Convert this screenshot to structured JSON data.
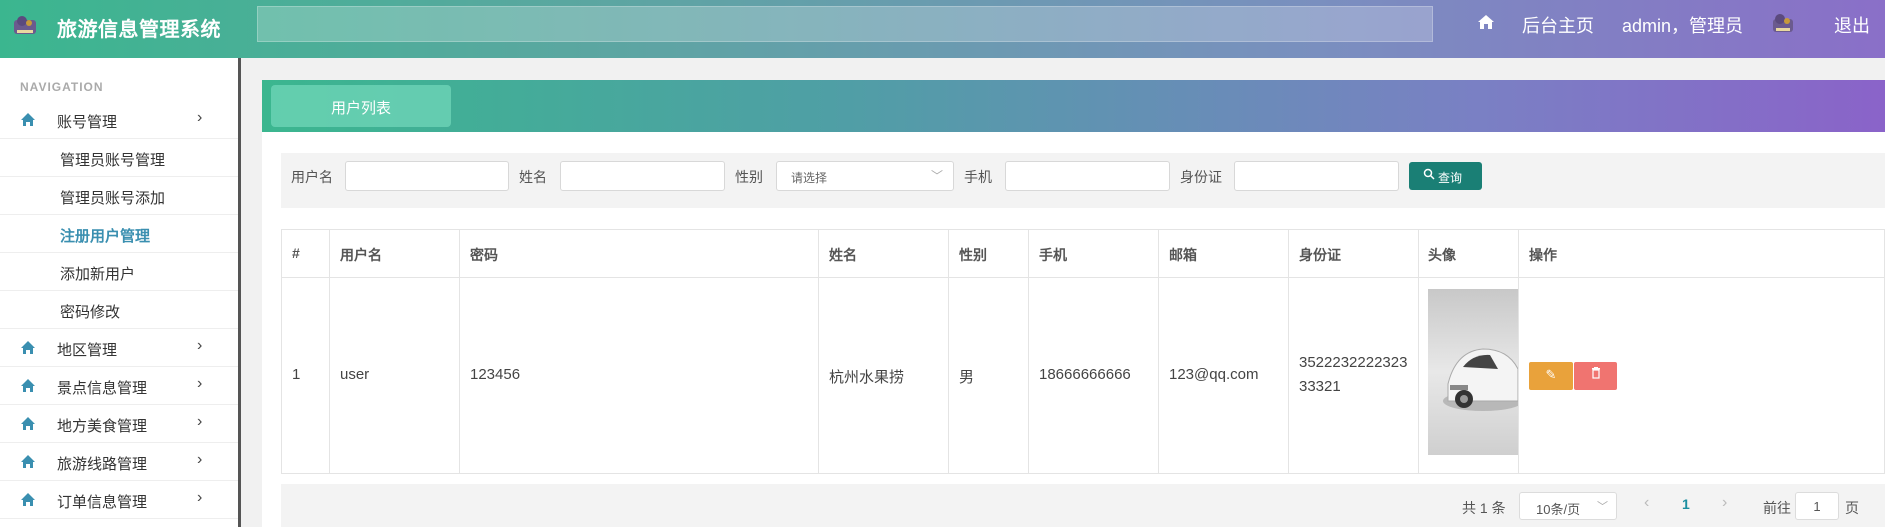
{
  "header": {
    "title": "旅游信息管理系统",
    "home_label": "后台主页",
    "user_label": "admin，管理员",
    "logout_label": "退出"
  },
  "sidebar": {
    "nav_title": "NAVIGATION",
    "account_menu": {
      "label": "账号管理",
      "children": [
        "管理员账号管理",
        "管理员账号添加",
        "注册用户管理",
        "添加新用户",
        "密码修改"
      ],
      "active_child": "注册用户管理"
    },
    "menus": [
      {
        "label": "地区管理"
      },
      {
        "label": "景点信息管理"
      },
      {
        "label": "地方美食管理"
      },
      {
        "label": "旅游线路管理"
      },
      {
        "label": "订单信息管理"
      }
    ]
  },
  "tab": {
    "label": "用户列表"
  },
  "search": {
    "username_label": "用户名",
    "name_label": "姓名",
    "gender_label": "性别",
    "gender_placeholder": "请选择",
    "phone_label": "手机",
    "id_label": "身份证",
    "button_label": "查询"
  },
  "table": {
    "headers": [
      "#",
      "用户名",
      "密码",
      "姓名",
      "性别",
      "手机",
      "邮箱",
      "身份证",
      "头像",
      "操作"
    ],
    "rows": [
      {
        "index": "1",
        "username": "user",
        "password": "123456",
        "name": "杭州水果捞",
        "gender": "男",
        "phone": "18666666666",
        "email": "123@qq.com",
        "id_line1": "3522232222323",
        "id_line2": "33321"
      }
    ]
  },
  "pagination": {
    "total": "共 1 条",
    "page_size": "10条/页",
    "current_page": "1",
    "goto_label": "前往",
    "goto_value": "1",
    "page_suffix": "页"
  },
  "colors": {
    "header_gradient_start": "#3bb68f",
    "header_gradient_end": "#8a6fc8",
    "search_button": "#1a7f75",
    "edit_button": "#e9a23b",
    "delete_button": "#f07470",
    "active_link": "#3a8fb0"
  }
}
